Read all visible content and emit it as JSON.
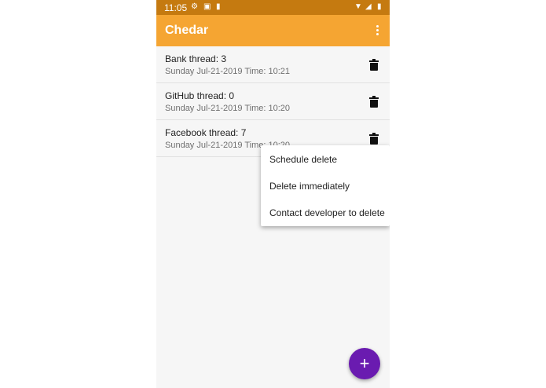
{
  "status_bar": {
    "time": "11:05"
  },
  "app_bar": {
    "title": "Chedar"
  },
  "threads": [
    {
      "name": "Bank thread: 3",
      "date": "Sunday Jul-21-2019 Time: 10:21"
    },
    {
      "name": "GitHub thread: 0",
      "date": "Sunday Jul-21-2019 Time: 10:20"
    },
    {
      "name": "Facebook thread: 7",
      "date": "Sunday Jul-21-2019 Time: 10:20"
    }
  ],
  "delete_menu": {
    "items": [
      "Schedule delete",
      "Delete immediately",
      "Contact developer to delete"
    ]
  },
  "fab": {
    "label": "+"
  },
  "colors": {
    "status_bar": "#c57a10",
    "app_bar": "#f5a532",
    "fab": "#6a1bb0"
  },
  "icons": [
    "settings-icon",
    "android-icon",
    "sd-card-icon",
    "wifi-icon",
    "signal-icon",
    "battery-icon",
    "overflow-menu-icon",
    "trash-icon",
    "plus-icon"
  ]
}
